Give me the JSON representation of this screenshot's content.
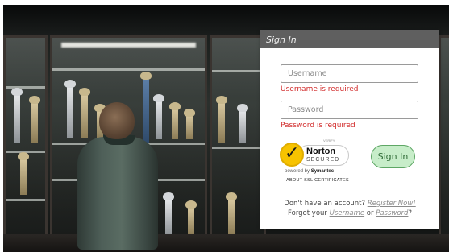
{
  "login": {
    "title": "Sign In",
    "username_placeholder": "Username",
    "username_error": "Username is required",
    "password_placeholder": "Password",
    "password_error": "Password is required",
    "sign_in_label": "Sign In",
    "no_account_text": "Don't have an account?",
    "register_link": "Register Now!",
    "forgot_text": "Forgot your",
    "username_link": "Username",
    "or_text": "or",
    "password_link": "Password",
    "question_mark": "?"
  },
  "norton": {
    "verify_text": "VERIFY",
    "name": "Norton",
    "secured": "SECURED",
    "powered_by": "powered by",
    "symantec": "Symantec",
    "about": "ABOUT SSL CERTIFICATES"
  },
  "colors": {
    "header_bg": "#5f5f5f",
    "error_red": "#d12a2a",
    "button_green": "#c7edc9",
    "button_border": "#5ea765"
  }
}
